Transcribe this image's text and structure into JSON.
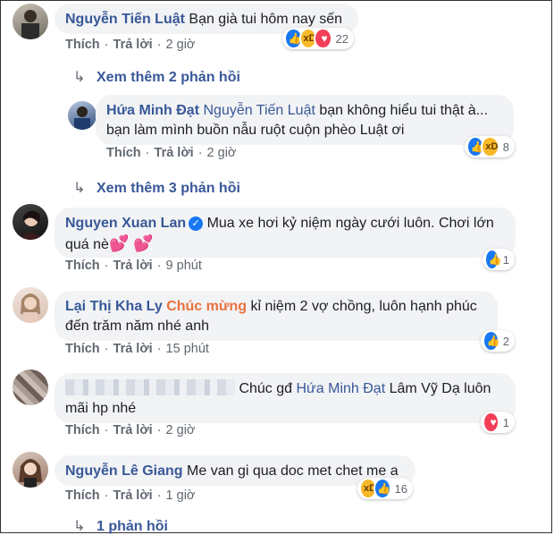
{
  "actions": {
    "like": "Thích",
    "reply": "Trả lời",
    "sep": "·"
  },
  "comments": [
    {
      "name": "Nguyễn Tiến Luật",
      "text": "Bạn già tui hôm nay sến",
      "time": "2 giờ",
      "react_count": "22"
    },
    {
      "name": "Hứa Minh Đạt",
      "mention": "Nguyễn Tiến Luật",
      "text1": "bạn không hiểu tui thật à...",
      "text2": "bạn làm mình buồn nẫu ruột cuộn phèo Luật ơi",
      "time": "2 giờ",
      "react_count": "8"
    },
    {
      "name": "Nguyen Xuan Lan",
      "text1": "Mua xe hơi kỷ niệm ngày cưới luôn. Chơi lớn",
      "text2": "quá nè",
      "time": "9 phút",
      "react_count": "1"
    },
    {
      "name": "Lại Thị Kha Ly",
      "tag": "Chúc mừng",
      "text1": "kỉ niệm 2 vợ chồng, luôn hạnh phúc",
      "text2": "đến trăm năm nhé anh",
      "time": "15 phút",
      "react_count": "2"
    },
    {
      "text_a": "Chúc gđ",
      "mention": "Hứa Minh Đạt",
      "text_b": "Lâm Vỹ Dạ luôn",
      "text2": "mãi hp nhé",
      "time": "2 giờ",
      "react_count": "1"
    },
    {
      "name": "Nguyễn Lê Giang",
      "text": "Me van gi qua doc met chet me a",
      "time": "1 giờ",
      "react_count": "16"
    }
  ],
  "more_replies": [
    "Xem thêm 2 phản hồi",
    "Xem thêm 3 phản hồi",
    "1 phản hồi"
  ]
}
